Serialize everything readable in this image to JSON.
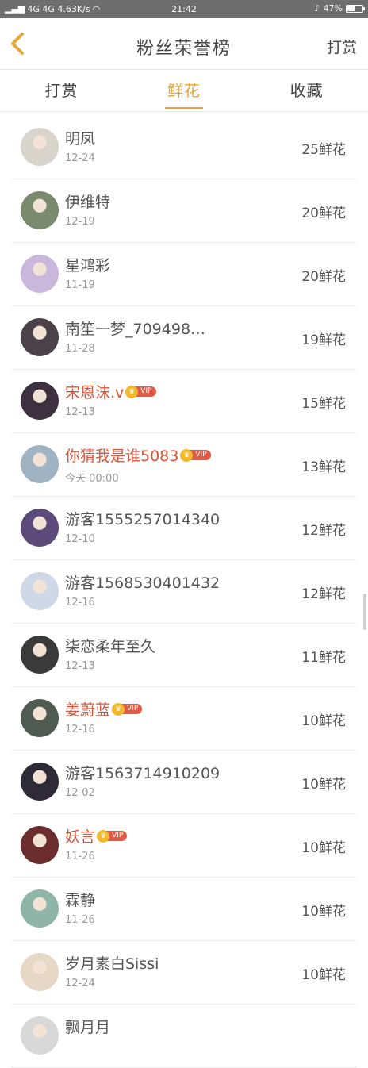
{
  "status_bar": {
    "left": "4G 4G 4.63K/s",
    "time": "21:42",
    "battery": "47%"
  },
  "header": {
    "title": "粉丝荣誉榜",
    "action_label": "打赏"
  },
  "tabs": [
    {
      "label": "打赏",
      "active": false
    },
    {
      "label": "鲜花",
      "active": true
    },
    {
      "label": "收藏",
      "active": false
    }
  ],
  "rows": [
    {
      "name": "明凤",
      "date": "12-24",
      "flowers": "25鲜花",
      "vip": false,
      "avatar_color": "#d9d4cc"
    },
    {
      "name": "伊维特",
      "date": "12-19",
      "flowers": "20鲜花",
      "vip": false,
      "avatar_color": "#7a8a6f"
    },
    {
      "name": "星鸿彩",
      "date": "11-19",
      "flowers": "20鲜花",
      "vip": false,
      "avatar_color": "#c9b7dc"
    },
    {
      "name": "南笙一梦_709498…",
      "date": "11-28",
      "flowers": "19鲜花",
      "vip": false,
      "avatar_color": "#4a4248"
    },
    {
      "name": "宋恩沫.v",
      "date": "12-13",
      "flowers": "15鲜花",
      "vip": true,
      "vip_label": "VIP",
      "avatar_color": "#3d3140"
    },
    {
      "name": "你猜我是谁5083",
      "date": "今天 00:00",
      "flowers": "13鲜花",
      "vip": true,
      "vip_label": "VIP",
      "avatar_color": "#9fb3c2"
    },
    {
      "name": "游客1555257014340",
      "date": "12-10",
      "flowers": "12鲜花",
      "vip": false,
      "avatar_color": "#5c4a7a"
    },
    {
      "name": "游客1568530401432",
      "date": "12-16",
      "flowers": "12鲜花",
      "vip": false,
      "avatar_color": "#cfd8e6"
    },
    {
      "name": "柒恋柔年至久",
      "date": "12-13",
      "flowers": "11鲜花",
      "vip": false,
      "avatar_color": "#3a3a3a"
    },
    {
      "name": "姜蔚蓝",
      "date": "12-16",
      "flowers": "10鲜花",
      "vip": true,
      "vip_label": "VIP",
      "avatar_color": "#4f5a50"
    },
    {
      "name": "游客1563714910209",
      "date": "12-02",
      "flowers": "10鲜花",
      "vip": false,
      "avatar_color": "#2e2a38"
    },
    {
      "name": "妖言",
      "date": "11-26",
      "flowers": "10鲜花",
      "vip": true,
      "vip_label": "VIP",
      "avatar_color": "#6b2d2d"
    },
    {
      "name": "霖静",
      "date": "11-26",
      "flowers": "10鲜花",
      "vip": false,
      "avatar_color": "#8fb5a8"
    },
    {
      "name": "岁月素白Sissi",
      "date": "12-24",
      "flowers": "10鲜花",
      "vip": false,
      "avatar_color": "#e6d7c7"
    },
    {
      "name": "飘月月",
      "date": "",
      "flowers": "",
      "vip": false,
      "avatar_color": "#d8d8d8"
    }
  ],
  "colors": {
    "accent": "#e6a73a",
    "vip_name": "#d9553a",
    "status_bar_bg": "#6e6e6e"
  },
  "icons": {
    "back": "chevron-left-icon"
  }
}
